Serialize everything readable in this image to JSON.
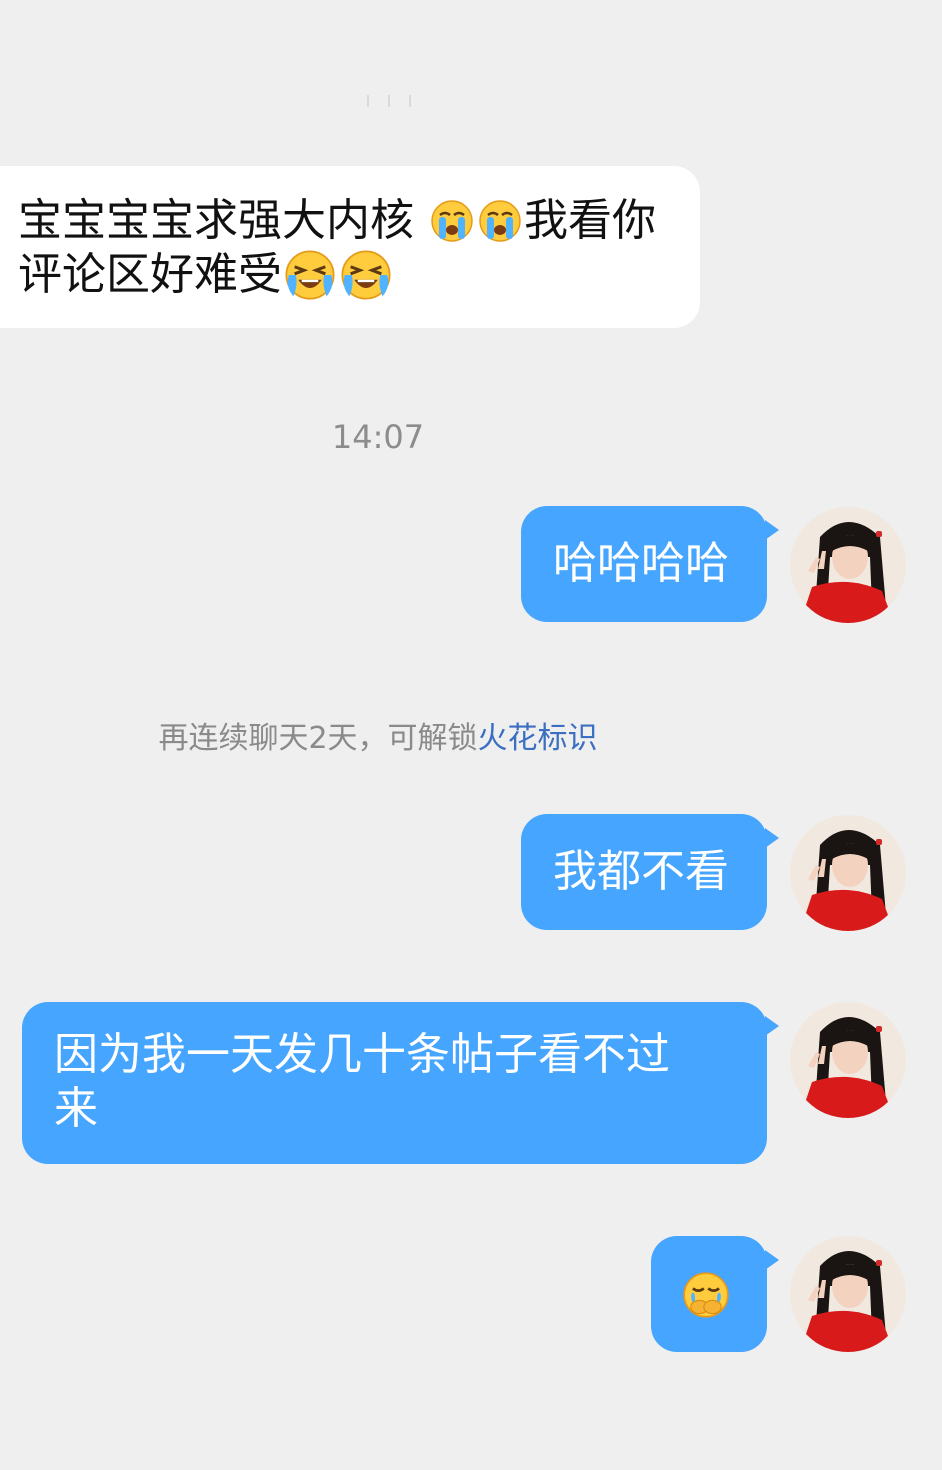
{
  "top_marker": "ı ı ı",
  "messages": {
    "incoming_1": {
      "line1_a": "宝宝宝宝求强大内核 ",
      "line1_b": "我看你",
      "line2_a": "评论区好难受",
      "emoji": "loudly-crying-face"
    },
    "timestamp": "14:07",
    "outgoing_1": {
      "text": "哈哈哈哈"
    },
    "spark_notice": {
      "prefix": "再连续聊天2天，可解锁",
      "link": "火花标识"
    },
    "outgoing_2": {
      "text": "我都不看"
    },
    "outgoing_3": {
      "line1": "因为我一天发几十条帖子看不过",
      "line2": "来"
    },
    "outgoing_4": {
      "emoji": "crying-covering-mouth-face"
    }
  },
  "colors": {
    "background": "#efefef",
    "incoming_bubble": "#ffffff",
    "outgoing_bubble": "#45a5ff",
    "link": "#3b6fc1",
    "muted_text": "#8a8a8a"
  }
}
